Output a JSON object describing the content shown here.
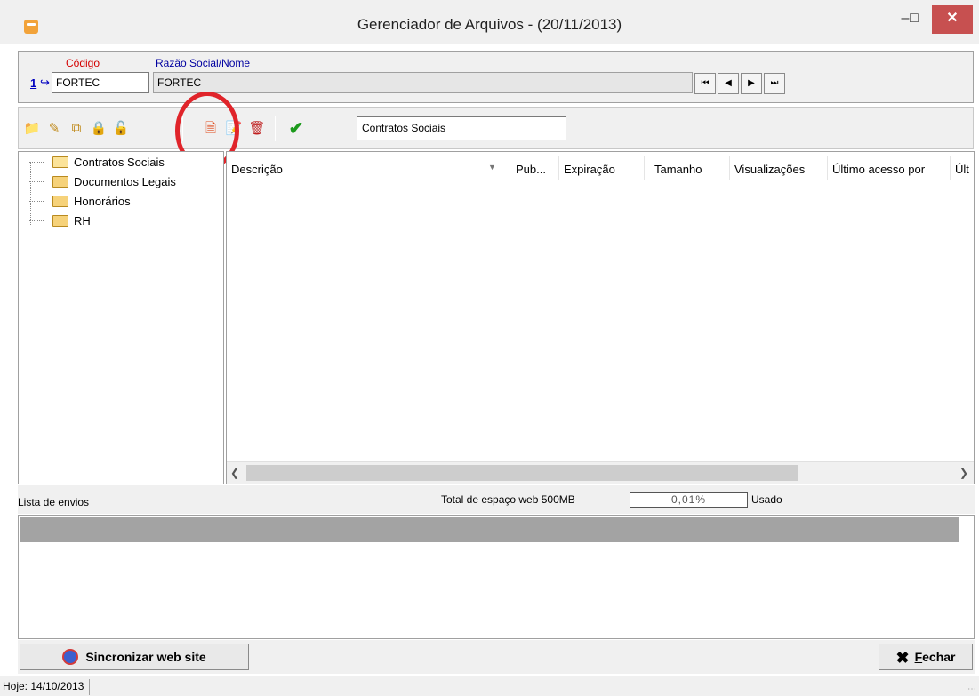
{
  "window": {
    "title": "Gerenciador de Arquivos - (20/11/2013)",
    "minimize_glyph": "–",
    "maximize_glyph": "□",
    "close_glyph": "✕"
  },
  "header": {
    "codigo_label": "Código",
    "razao_label": "Razão Social/Nome",
    "record_number": "1",
    "record_arrow": "↪",
    "codigo_value": "FORTEC",
    "razao_value": "FORTEC"
  },
  "navigation": {
    "first": "⏮",
    "prev": "◀",
    "next": "▶",
    "last": "⏭"
  },
  "toolbar": {
    "current_folder": "Contratos Sociais",
    "icons": [
      "folder-new-icon",
      "folder-edit-icon",
      "folder-copy-icon",
      "lock-icon",
      "unlock-icon",
      "file-new-icon",
      "file-edit-icon",
      "file-delete-icon",
      "check-icon"
    ]
  },
  "folders": [
    {
      "label": "Contratos Sociais"
    },
    {
      "label": "Documentos Legais"
    },
    {
      "label": "Honorários"
    },
    {
      "label": "RH"
    }
  ],
  "file_list": {
    "columns": [
      "Descrição",
      "Pub...",
      "Expiração",
      "Tamanho",
      "Visualizações",
      "Último acesso por",
      "Últ"
    ],
    "rows": []
  },
  "status": {
    "lista_label": "Lista de envios",
    "total_label": "Total de espaço web 500MB",
    "usage_percent": "0,01%",
    "usado_label": "Usado"
  },
  "buttons": {
    "sync": "Sincronizar web site",
    "close_prefix": "F",
    "close_rest": "echar"
  },
  "statusbar": {
    "today": "Hoje: 14/10/2013"
  },
  "colors": {
    "close_button": "#c75050",
    "codigo_label": "#d40000",
    "razao_label": "#0000a0",
    "highlight_circle": "#e0242a",
    "check": "#1c9a1c"
  }
}
